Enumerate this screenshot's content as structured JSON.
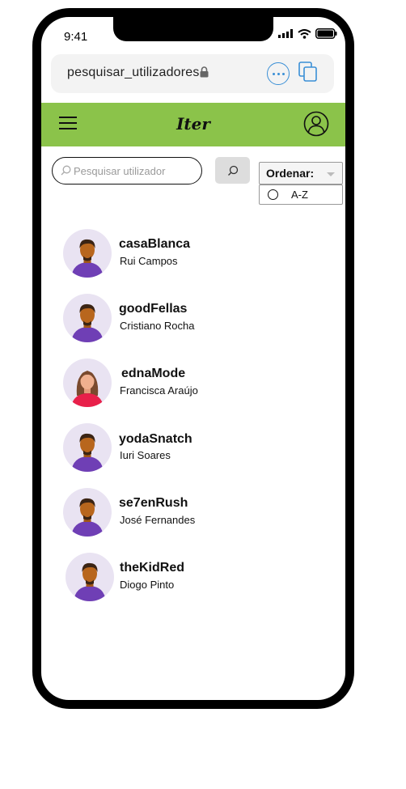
{
  "status_bar": {
    "time": "9:41"
  },
  "browser": {
    "url": "pesquisar_utilizadores"
  },
  "app": {
    "brand": "Iter"
  },
  "search": {
    "placeholder": "Pesquisar  utilizador"
  },
  "sort": {
    "label": "Ordenar:",
    "options": [
      "A-Z"
    ]
  },
  "users": [
    {
      "username": "casaBlanca",
      "name": "Rui Campos",
      "avatar": "male-avatar"
    },
    {
      "username": "goodFellas",
      "name": "Cristiano Rocha",
      "avatar": "male-avatar"
    },
    {
      "username": "ednaMode",
      "name": "Francisca Araújo",
      "avatar": "female-avatar"
    },
    {
      "username": "yodaSnatch",
      "name": "Iuri Soares",
      "avatar": "male-avatar"
    },
    {
      "username": "se7enRush",
      "name": "José Fernandes",
      "avatar": "male-avatar"
    },
    {
      "username": "theKidRed",
      "name": "Diogo Pinto",
      "avatar": "male-avatar"
    }
  ],
  "colors": {
    "appbar": "#8bc34a",
    "accent": "#3a8fd6",
    "avatar_shirt": "#6f3fb5",
    "avatar_bg": "#e9e3f2"
  }
}
